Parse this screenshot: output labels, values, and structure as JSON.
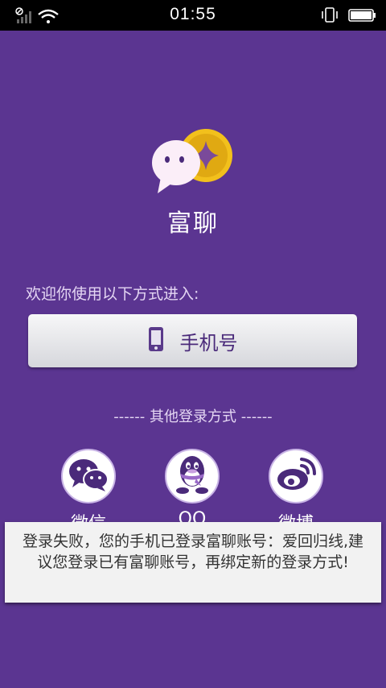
{
  "status_bar": {
    "time": "01:55",
    "icons": [
      "signal-icon",
      "wifi-icon",
      "vibrate-icon",
      "battery-icon"
    ]
  },
  "app": {
    "name": "富聊",
    "colors": {
      "background": "#5b3591",
      "accent": "#4a2a7a",
      "coin": "#f2c01c"
    }
  },
  "login": {
    "welcome": "欢迎你使用以下方式进入:",
    "phone_button": "手机号",
    "other_methods": "------ 其他登录方式 ------",
    "social": [
      {
        "label": "微信",
        "icon": "wechat-icon"
      },
      {
        "label": "QQ",
        "icon": "qq-icon"
      },
      {
        "label": "微博",
        "icon": "weibo-icon"
      }
    ]
  },
  "toast": {
    "message": "登录失败，您的手机已登录富聊账号：爱回归线,建议您登录已有富聊账号，再绑定新的登录方式!"
  }
}
